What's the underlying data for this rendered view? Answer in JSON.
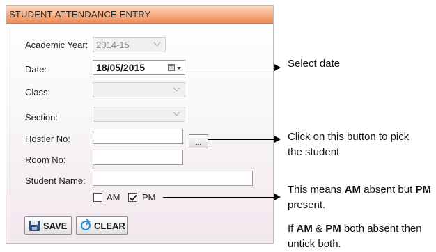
{
  "window": {
    "title": "STUDENT ATTENDANCE ENTRY"
  },
  "form": {
    "academic_year": {
      "label": "Academic Year:",
      "value": "2014-15"
    },
    "date": {
      "label": "Date:",
      "value": "18/05/2015"
    },
    "class": {
      "label": "Class:",
      "value": ""
    },
    "section": {
      "label": "Section:",
      "value": ""
    },
    "hostler_no": {
      "label": "Hostler No:",
      "value": "",
      "picker_label": "..."
    },
    "room_no": {
      "label": "Room No:",
      "value": ""
    },
    "student_name": {
      "label": "Student Name:",
      "value": ""
    },
    "am": {
      "label": "AM",
      "checked": false
    },
    "pm": {
      "label": "PM",
      "checked": true
    },
    "save_label": "SAVE",
    "clear_label": "CLEAR"
  },
  "annotations": {
    "date": "Select date",
    "picker_line1": "Click on this button to pick",
    "picker_line2": "the student",
    "meaning": {
      "a": "This means ",
      "b": "AM",
      "c": " absent but ",
      "d": "PM",
      "e": "present."
    },
    "both": {
      "a": "If ",
      "b": "AM",
      "c": " & ",
      "d": "PM",
      "e": " both absent  then",
      "f": "untick both."
    }
  },
  "colors": {
    "title_gradient_end": "#ef8a55",
    "accent_icon": "#2d8bd1"
  }
}
